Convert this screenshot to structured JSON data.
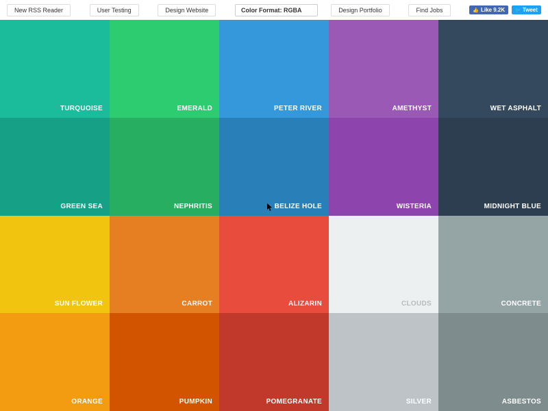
{
  "header": {
    "nav": [
      "New RSS Reader",
      "User Testing",
      "Design Website"
    ],
    "format_label": "Color Format: RGBA",
    "nav_right": [
      "Design Portfolio",
      "Find Jobs"
    ],
    "fb_like": "Like 9.2K",
    "tweet": "Tweet"
  },
  "colors": [
    {
      "name": "TURQUOISE",
      "hex": "#1abc9c",
      "light": false
    },
    {
      "name": "EMERALD",
      "hex": "#2ecc71",
      "light": false
    },
    {
      "name": "PETER RIVER",
      "hex": "#3498db",
      "light": false
    },
    {
      "name": "AMETHYST",
      "hex": "#9b59b6",
      "light": false
    },
    {
      "name": "WET ASPHALT",
      "hex": "#34495e",
      "light": false
    },
    {
      "name": "GREEN SEA",
      "hex": "#16a085",
      "light": false
    },
    {
      "name": "NEPHRITIS",
      "hex": "#27ae60",
      "light": false
    },
    {
      "name": "BELIZE HOLE",
      "hex": "#2980b9",
      "light": false
    },
    {
      "name": "WISTERIA",
      "hex": "#8e44ad",
      "light": false
    },
    {
      "name": "MIDNIGHT BLUE",
      "hex": "#2c3e50",
      "light": false
    },
    {
      "name": "SUN FLOWER",
      "hex": "#f1c40f",
      "light": false
    },
    {
      "name": "CARROT",
      "hex": "#e67e22",
      "light": false
    },
    {
      "name": "ALIZARIN",
      "hex": "#e74c3c",
      "light": false
    },
    {
      "name": "CLOUDS",
      "hex": "#ecf0f1",
      "light": true
    },
    {
      "name": "CONCRETE",
      "hex": "#95a5a6",
      "light": false
    },
    {
      "name": "ORANGE",
      "hex": "#f39c12",
      "light": false
    },
    {
      "name": "PUMPKIN",
      "hex": "#d35400",
      "light": false
    },
    {
      "name": "POMEGRANATE",
      "hex": "#c0392b",
      "light": false
    },
    {
      "name": "SILVER",
      "hex": "#bdc3c7",
      "light": false
    },
    {
      "name": "ASBESTOS",
      "hex": "#7f8c8d",
      "light": false
    }
  ]
}
